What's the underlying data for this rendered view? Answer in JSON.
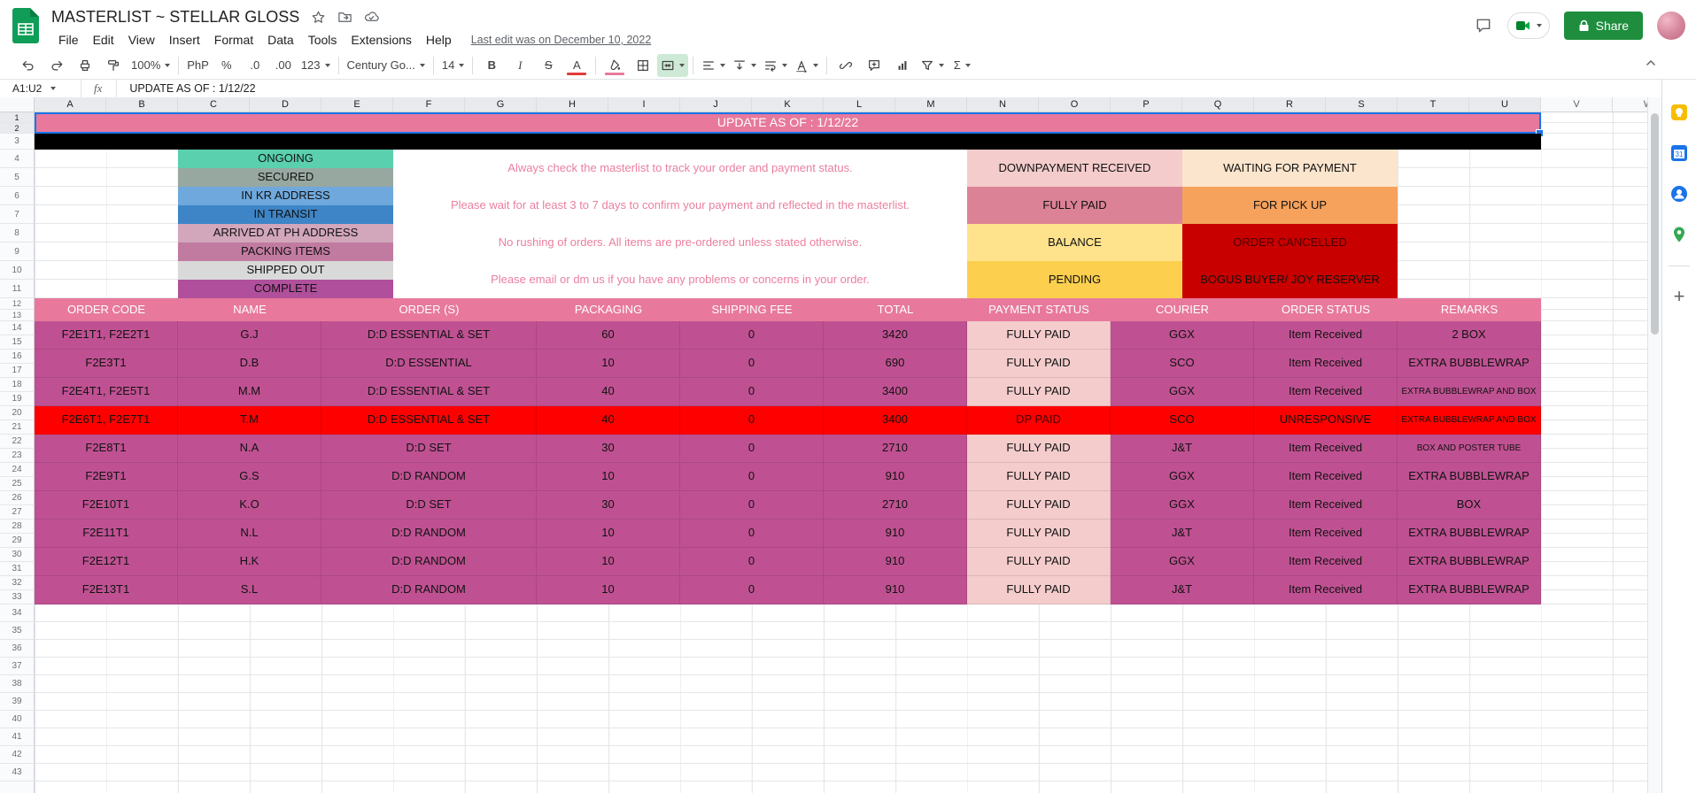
{
  "titlebar": {
    "title": "MASTERLIST ~ STELLAR GLOSS",
    "menus": [
      "File",
      "Edit",
      "View",
      "Insert",
      "Format",
      "Data",
      "Tools",
      "Extensions",
      "Help"
    ],
    "last_edit": "Last edit was on December 10, 2022",
    "share_label": "Share"
  },
  "toolbar": {
    "zoom": "100%",
    "currency": "PhP",
    "percent": "%",
    "dec_decrease": ".0",
    "dec_increase": ".00",
    "more_formats": "123",
    "font_name": "Century Go...",
    "font_size": "14",
    "bold": "B",
    "italic": "I",
    "strikethrough": "S",
    "text_color": "A",
    "functions": "Σ"
  },
  "formula_bar": {
    "name_box": "A1:U2",
    "fx": "fx",
    "value": "UPDATE AS OF : 1/12/22"
  },
  "grid": {
    "column_letters": [
      "A",
      "B",
      "C",
      "D",
      "E",
      "F",
      "G",
      "H",
      "I",
      "J",
      "K",
      "L",
      "M",
      "N",
      "O",
      "P",
      "Q",
      "R",
      "S",
      "T",
      "U",
      "V",
      "W"
    ],
    "row_count": 43,
    "banner": "UPDATE AS OF : 1/12/22",
    "legend_left": [
      {
        "label": "ONGOING",
        "bg": "#5ad0ae"
      },
      {
        "label": "SECURED",
        "bg": "#97a8a1"
      },
      {
        "label": "IN KR ADDRESS",
        "bg": "#6fa8dc"
      },
      {
        "label": "IN TRANSIT",
        "bg": "#3d85c6"
      },
      {
        "label": "ARRIVED AT PH ADDRESS",
        "bg": "#d2a6bb"
      },
      {
        "label": "PACKING ITEMS",
        "bg": "#c27ba0"
      },
      {
        "label": "SHIPPED OUT",
        "bg": "#d9d9d9"
      },
      {
        "label": "COMPLETE",
        "bg": "#b04f9b"
      }
    ],
    "notes": [
      "Always check the masterlist to track your order and payment status.",
      "Please wait for at least 3 to 7 days to confirm your payment and reflected in the masterlist.",
      "No rushing of orders. All items are pre-ordered unless stated otherwise.",
      "Please email or dm us if you have any problems or concerns in your order."
    ],
    "legend_right": [
      [
        {
          "label": "DOWNPAYMENT RECEIVED",
          "bg": "#f4cccc",
          "fg": "#111111"
        },
        {
          "label": "WAITING FOR PAYMENT",
          "bg": "#fce5cd",
          "fg": "#111111"
        }
      ],
      [
        {
          "label": "FULLY PAID",
          "bg": "#dc8296",
          "fg": "#111111"
        },
        {
          "label": "FOR PICK UP",
          "bg": "#f6a25c",
          "fg": "#111111"
        }
      ],
      [
        {
          "label": "BALANCE",
          "bg": "#ffe28c",
          "fg": "#111111"
        },
        {
          "label": "ORDER CANCELLED",
          "bg": "#c80000",
          "fg": "#4a0000"
        }
      ],
      [
        {
          "label": "PENDING",
          "bg": "#fccf4e",
          "fg": "#111111"
        },
        {
          "label": "BOGUS BUYER/ JOY RESERVER",
          "bg": "#c80000",
          "fg": "#111111"
        }
      ]
    ],
    "table": {
      "headers": [
        "ORDER CODE",
        "NAME",
        "ORDER (S)",
        "PACKAGING",
        "SHIPPING FEE",
        "TOTAL",
        "PAYMENT STATUS",
        "COURIER",
        "ORDER STATUS",
        "REMARKS"
      ],
      "rows": [
        {
          "red": false,
          "cells": [
            "F2E1T1, F2E2T1",
            "G.J",
            "D:D ESSENTIAL & SET",
            "60",
            "0",
            "3420",
            "FULLY PAID",
            "GGX",
            "Item Received",
            "2 BOX"
          ]
        },
        {
          "red": false,
          "cells": [
            "F2E3T1",
            "D.B",
            "D:D ESSENTIAL",
            "10",
            "0",
            "690",
            "FULLY PAID",
            "SCO",
            "Item Received",
            "EXTRA BUBBLEWRAP"
          ]
        },
        {
          "red": false,
          "cells": [
            "F2E4T1, F2E5T1",
            "M.M",
            "D:D ESSENTIAL & SET",
            "40",
            "0",
            "3400",
            "FULLY PAID",
            "GGX",
            "Item Received",
            "EXTRA BUBBLEWRAP AND BOX"
          ]
        },
        {
          "red": true,
          "cells": [
            "F2E6T1, F2E7T1",
            "T.M",
            "D:D ESSENTIAL & SET",
            "40",
            "0",
            "3400",
            "DP PAID",
            "SCO",
            "UNRESPONSIVE",
            "EXTRA BUBBLEWRAP AND BOX"
          ]
        },
        {
          "red": false,
          "cells": [
            "F2E8T1",
            "N.A",
            "D:D SET",
            "30",
            "0",
            "2710",
            "FULLY PAID",
            "J&T",
            "Item Received",
            "BOX AND POSTER TUBE"
          ]
        },
        {
          "red": false,
          "cells": [
            "F2E9T1",
            "G.S",
            "D:D RANDOM",
            "10",
            "0",
            "910",
            "FULLY PAID",
            "GGX",
            "Item Received",
            "EXTRA BUBBLEWRAP"
          ]
        },
        {
          "red": false,
          "cells": [
            "F2E10T1",
            "K.O",
            "D:D SET",
            "30",
            "0",
            "2710",
            "FULLY PAID",
            "GGX",
            "Item Received",
            "BOX"
          ]
        },
        {
          "red": false,
          "cells": [
            "F2E11T1",
            "N.L",
            "D:D RANDOM",
            "10",
            "0",
            "910",
            "FULLY PAID",
            "J&T",
            "Item Received",
            "EXTRA BUBBLEWRAP"
          ]
        },
        {
          "red": false,
          "cells": [
            "F2E12T1",
            "H.K",
            "D:D RANDOM",
            "10",
            "0",
            "910",
            "FULLY PAID",
            "GGX",
            "Item Received",
            "EXTRA BUBBLEWRAP"
          ]
        },
        {
          "red": false,
          "cells": [
            "F2E13T1",
            "S.L",
            "D:D RANDOM",
            "10",
            "0",
            "910",
            "FULLY PAID",
            "J&T",
            "Item Received",
            "EXTRA BUBBLEWRAP"
          ]
        }
      ]
    }
  },
  "colors": {
    "accent_pink": "#e8799c",
    "row_magenta": "#bf5192",
    "payment_light": "#f4cccc",
    "alert_red": "#fe0000",
    "selection_blue": "#1a73e8",
    "share_green": "#1e8e3e"
  },
  "side_panel": {
    "icons": [
      "keep-icon",
      "calendar-icon",
      "contacts-icon",
      "maps-icon"
    ],
    "add_label": "+"
  }
}
